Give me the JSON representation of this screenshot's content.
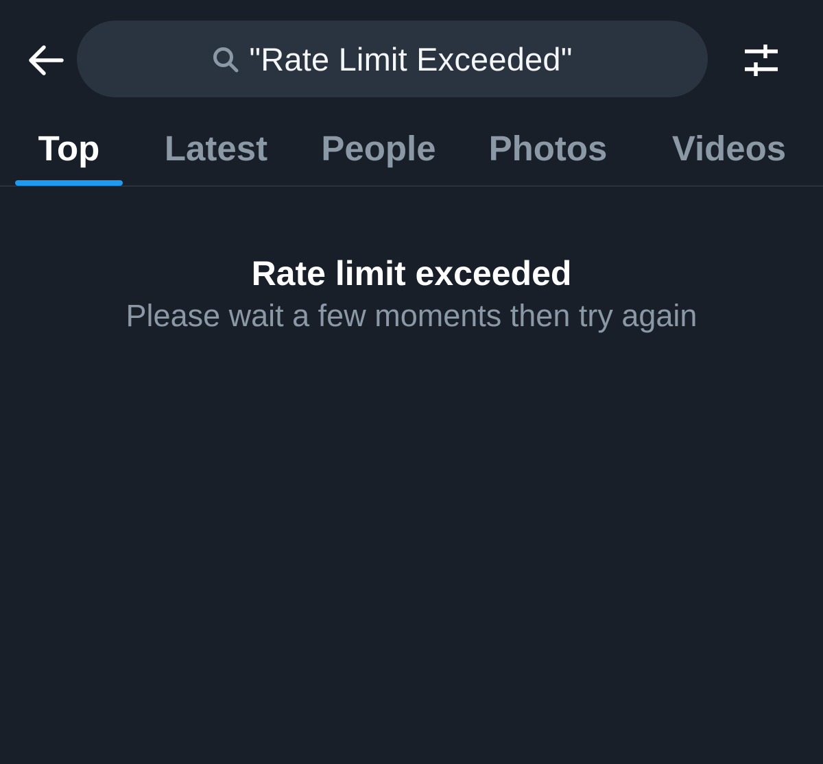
{
  "header": {
    "back_icon": "arrow-left-icon",
    "search": {
      "icon": "search-icon",
      "query": "\"Rate Limit Exceeded\""
    },
    "filter_icon": "sliders-icon"
  },
  "tabs": [
    {
      "label": "Top",
      "active": true
    },
    {
      "label": "Latest",
      "active": false
    },
    {
      "label": "People",
      "active": false
    },
    {
      "label": "Photos",
      "active": false
    },
    {
      "label": "Videos",
      "active": false
    }
  ],
  "message": {
    "title": "Rate limit exceeded",
    "subtitle": "Please wait a few moments then try again"
  },
  "colors": {
    "background": "#181f29",
    "search_bg": "#2a3440",
    "accent": "#1d9bf0",
    "muted_text": "#8b98a5",
    "primary_text": "#ffffff"
  }
}
